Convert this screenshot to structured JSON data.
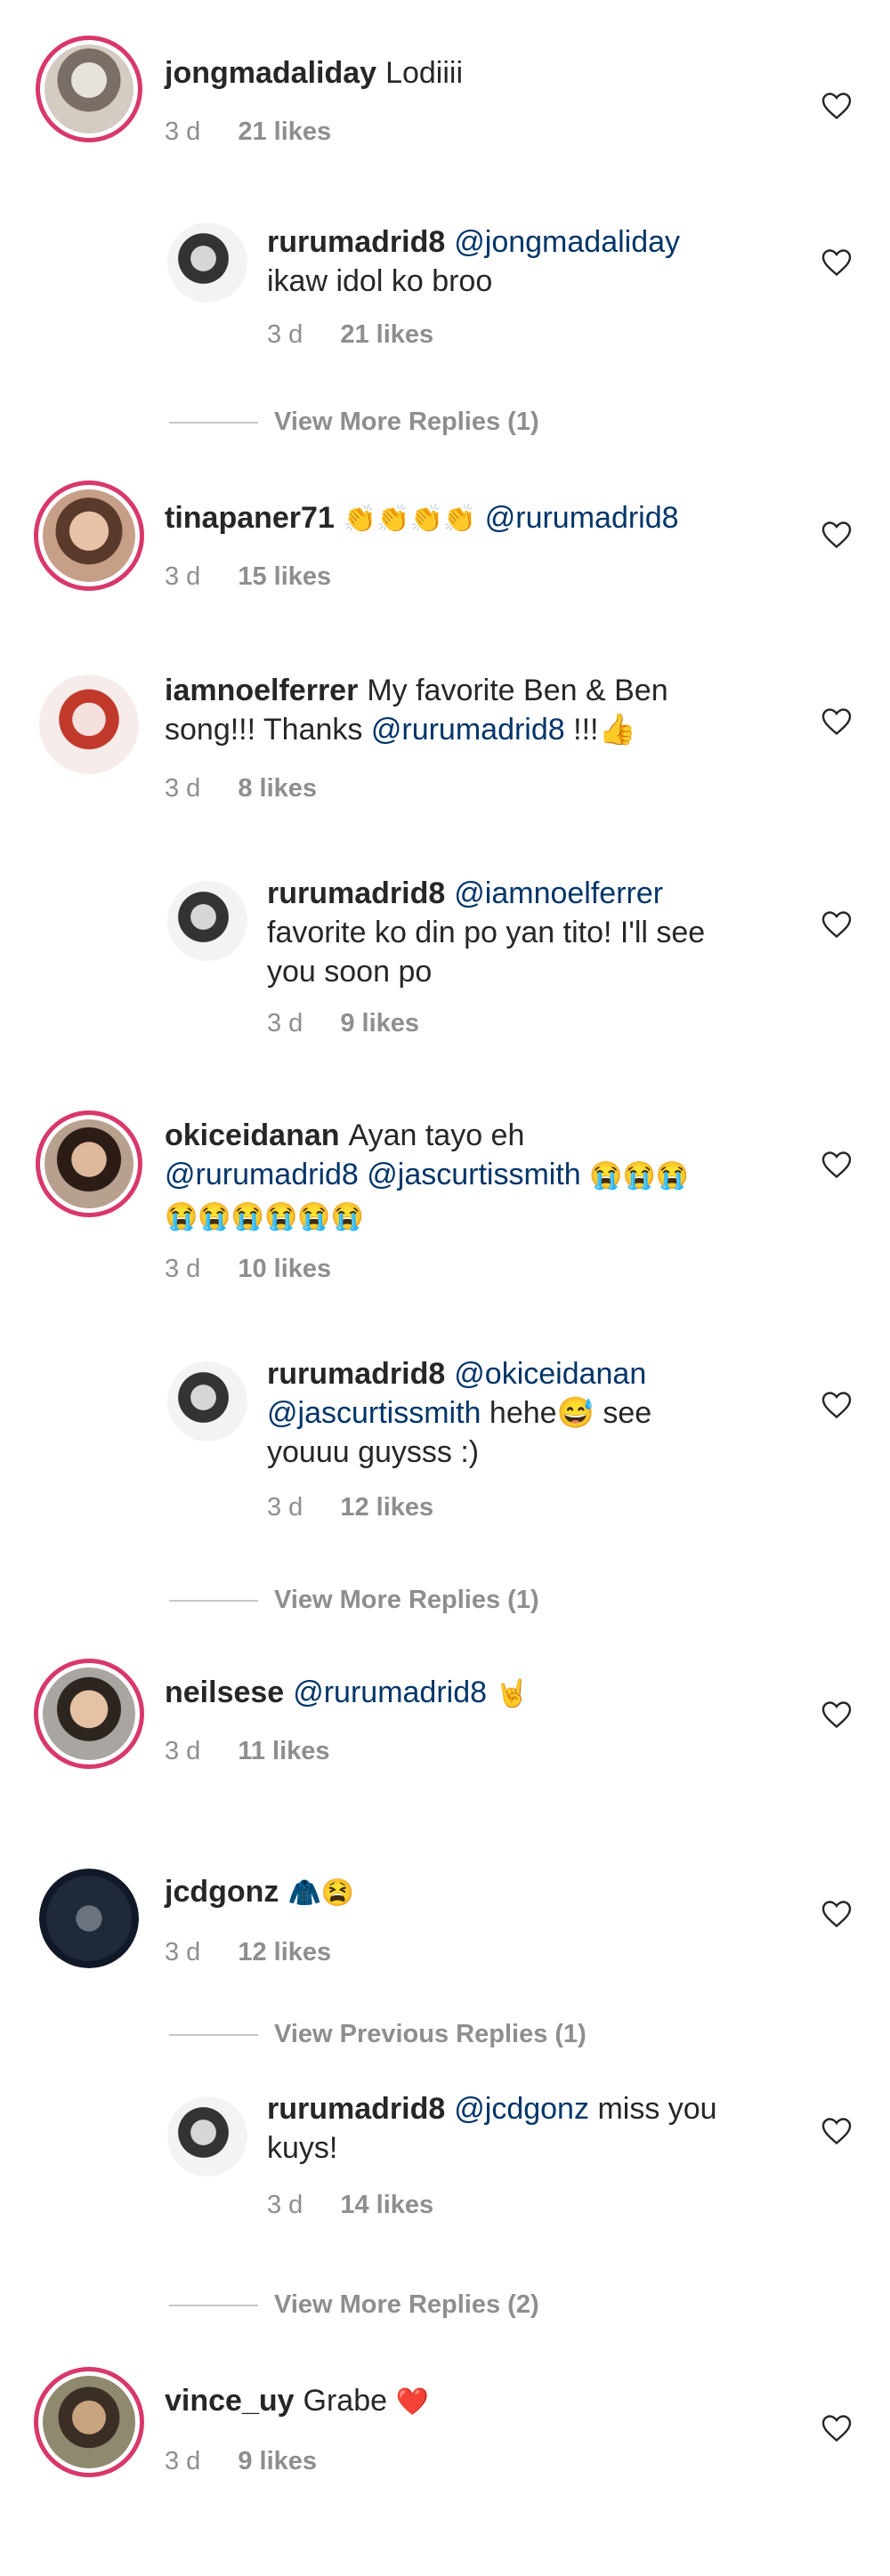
{
  "comments": [
    {
      "user": "jongmadaliday",
      "text": "Lodiiii",
      "time": "3 d",
      "likes": "21 likes"
    },
    {
      "user": "rurumadrid8",
      "mention": "@jongmadaliday",
      "text": "ikaw idol ko broo",
      "time": "3 d",
      "likes": "21 likes"
    },
    {
      "view_more": "View More Replies (1)"
    },
    {
      "user": "tinapaner71",
      "emoji": "👏👏👏👏",
      "mention": "@rurumadrid8",
      "time": "3 d",
      "likes": "15 likes"
    },
    {
      "user": "iamnoelferrer",
      "text_line1": "My favorite Ben & Ben",
      "text_line2": "song!!! Thanks",
      "mention": "@rurumadrid8",
      "text_after": "!!!👍",
      "time": "3 d",
      "likes": "8 likes"
    },
    {
      "user": "rurumadrid8",
      "mention": "@iamnoelferrer",
      "text_line1": "favorite ko din po yan tito! I'll see",
      "text_line2": "you soon po",
      "time": "3 d",
      "likes": "9 likes"
    },
    {
      "user": "okiceidanan",
      "text": "Ayan tayo eh",
      "mention1": "@rurumadrid8",
      "mention2": "@jascurtissmith",
      "emoji1": "😭😭😭",
      "emoji2": "😭😭😭😭😭😭",
      "time": "3 d",
      "likes": "10 likes"
    },
    {
      "user": "rurumadrid8",
      "mention1": "@okiceidanan",
      "mention2": "@jascurtissmith",
      "text": "hehe😅 see",
      "text_line2": "youuu guysss :)",
      "time": "3 d",
      "likes": "12 likes"
    },
    {
      "view_more": "View More Replies (1)"
    },
    {
      "user": "neilsese",
      "mention": "@rurumadrid8",
      "emoji": "🤘",
      "time": "3 d",
      "likes": "11 likes"
    },
    {
      "user": "jcdgonz",
      "emoji": "🧥😫",
      "time": "3 d",
      "likes": "12 likes"
    },
    {
      "view_previous": "View Previous Replies (1)"
    },
    {
      "user": "rurumadrid8",
      "mention": "@jcdgonz",
      "text": "miss you",
      "text_line2": "kuys!",
      "time": "3 d",
      "likes": "14 likes"
    },
    {
      "view_more": "View More Replies (2)"
    },
    {
      "user": "vince_uy",
      "text": "Grabe",
      "emoji": "❤️",
      "time": "3 d",
      "likes": "9 likes"
    }
  ]
}
